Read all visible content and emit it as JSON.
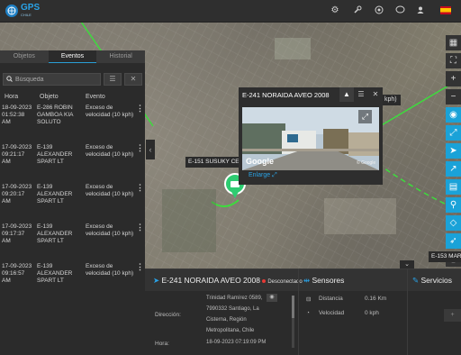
{
  "topbar": {
    "logo_text": "GPS",
    "logo_subtext": "CHILE",
    "icons": [
      "settings-icon",
      "wrench-icon",
      "target-icon",
      "chat-icon",
      "user-icon"
    ],
    "flag": "spain-flag"
  },
  "left_panel": {
    "tabs": [
      {
        "label": "Objetos",
        "active": false
      },
      {
        "label": "Eventos",
        "active": true
      },
      {
        "label": "Historial",
        "active": false
      }
    ],
    "search": {
      "placeholder": "Búsqueda",
      "value": ""
    },
    "columns": [
      "Hora",
      "Objeto",
      "Evento"
    ],
    "rows": [
      {
        "time": "18-09-2023 01:52:38 AM",
        "object": "E-286 ROBIN GAMBOA KIA SOLUTO",
        "event": "Exceso de velocidad (10 kph)"
      },
      {
        "time": "17-09-2023 09:21:17 AM",
        "object": "E-139 ALEXANDER SPART LT",
        "event": "Exceso de velocidad (10 kph)"
      },
      {
        "time": "17-09-2023 09:20:17 AM",
        "object": "E-139 ALEXANDER SPART LT",
        "event": "Exceso de velocidad (10 kph)"
      },
      {
        "time": "17-09-2023 09:17:37 AM",
        "object": "E-139 ALEXANDER SPART LT",
        "event": "Exceso de velocidad (10 kph)"
      },
      {
        "time": "17-09-2023 09:16:57 AM",
        "object": "E-139 ALEXANDER SPART LT",
        "event": "Exceso de velocidad (10 kph)"
      }
    ]
  },
  "popup": {
    "title": "E-241 NORAIDA AVEO 2008",
    "google_label": "Google",
    "copyright": "© Google",
    "enlarge_label": "Enlarge",
    "kph_badge": "kph)"
  },
  "map_labels": {
    "susuky": "E-151 SUSUKY CE",
    "corner": "E-153 MAR"
  },
  "bottom_panel": {
    "vehicle": "E-241 NORAIDA AVEO 2008",
    "status": "Desconectado",
    "sensors_title": "Sensores",
    "services_title": "Servicios",
    "direccion_label": "Dirección:",
    "direccion_lines": [
      "Trinidad Ramírez 0589,",
      "7990332 Santiago, La",
      "Cisterna, Región",
      "Metropolitana, Chile"
    ],
    "hora_label": "Hora:",
    "hora_value": "18-09-2023 07:19:09 PM",
    "sensors": [
      {
        "label": "Distancia",
        "value": "0.16 Km"
      },
      {
        "label": "Velocidad",
        "value": "0 kph"
      }
    ],
    "add_label": "+"
  },
  "colors": {
    "accent": "#1aa2d8",
    "route": "#3ddc3d",
    "marker": "#2ecc71",
    "status": "#e53935"
  }
}
